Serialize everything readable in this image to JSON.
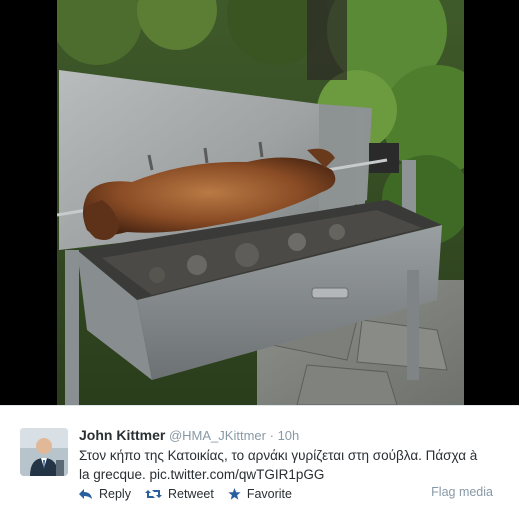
{
  "tweet": {
    "fullname": "John Kittmer",
    "username": "@HMA_JKittmer",
    "separator": "·",
    "time": "10h",
    "text_line1": "Στον κήπο της Κατοικίας, το αρνάκι γυρίζεται στη σούβλα. Πάσχα à",
    "text_line2": "la grecque. pic.twitter.com/qwTGIR1pGG"
  },
  "actions": {
    "reply_label": "Reply",
    "retweet_label": "Retweet",
    "favorite_label": "Favorite",
    "flag_label": "Flag media"
  },
  "colors": {
    "action_blue": "#2a5f9e",
    "muted_gray": "#8899a6",
    "text_dark": "#292f33"
  },
  "icons": [
    "reply-icon",
    "retweet-icon",
    "favorite-star-icon"
  ]
}
